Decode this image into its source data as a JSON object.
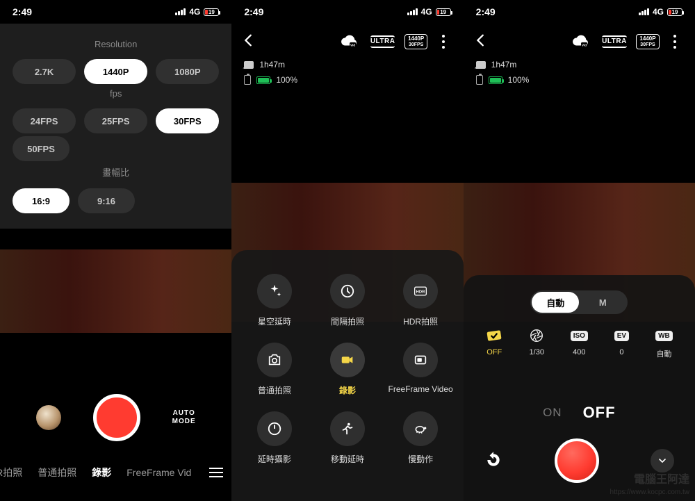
{
  "status": {
    "time": "2:49",
    "network": "4G",
    "battery_pct": "19"
  },
  "screenA": {
    "sections": {
      "resolution": {
        "label": "Resolution",
        "options": [
          "2.7K",
          "1440P",
          "1080P"
        ],
        "selected": "1440P"
      },
      "fps": {
        "label": "fps",
        "options": [
          "24FPS",
          "25FPS",
          "30FPS",
          "50FPS"
        ],
        "selected": "30FPS"
      },
      "aspect": {
        "label": "畫幅比",
        "options": [
          "16:9",
          "9:16"
        ],
        "selected": "16:9"
      }
    },
    "automode": {
      "line1": "AUTO",
      "line2": "MODE"
    },
    "modes": {
      "items": [
        "DR拍照",
        "普通拍照",
        "錄影",
        "FreeFrame Vid"
      ],
      "active": "錄影"
    }
  },
  "header": {
    "ultra": "ULTRA",
    "reschip": {
      "top": "1440P",
      "bottom": "30FPS"
    },
    "storage": "1h47m",
    "battery": "100%"
  },
  "screenB": {
    "modes": [
      {
        "id": "starlapse",
        "label": "星空延時",
        "icon": "sparkle"
      },
      {
        "id": "interval",
        "label": "間隔拍照",
        "icon": "clock"
      },
      {
        "id": "hdr",
        "label": "HDR拍照",
        "icon": "hdr"
      },
      {
        "id": "photo",
        "label": "普通拍照",
        "icon": "camera"
      },
      {
        "id": "video",
        "label": "錄影",
        "icon": "video",
        "selected": true
      },
      {
        "id": "freeframe",
        "label": "FreeFrame Video",
        "icon": "freeframe"
      },
      {
        "id": "timelapse",
        "label": "延時攝影",
        "icon": "timelapse"
      },
      {
        "id": "hyperlapse",
        "label": "移動延時",
        "icon": "run"
      },
      {
        "id": "slowmo",
        "label": "慢動作",
        "icon": "turtle"
      }
    ]
  },
  "screenC": {
    "seg": {
      "options": [
        "自動",
        "M"
      ],
      "selected": "自動"
    },
    "params": [
      {
        "id": "stab",
        "icon": "stab",
        "value": "OFF",
        "selected": true
      },
      {
        "id": "shutter",
        "icon": "aperture",
        "value": "1/30"
      },
      {
        "id": "iso",
        "icon": "ISO",
        "value": "400"
      },
      {
        "id": "ev",
        "icon": "EV",
        "value": "0"
      },
      {
        "id": "wb",
        "icon": "WB",
        "value": "自動"
      }
    ],
    "toggle": {
      "options": [
        "ON",
        "OFF"
      ],
      "selected": "OFF"
    }
  },
  "watermark": {
    "title": "電腦王阿達",
    "url": "https://www.kocpc.com.tw"
  }
}
